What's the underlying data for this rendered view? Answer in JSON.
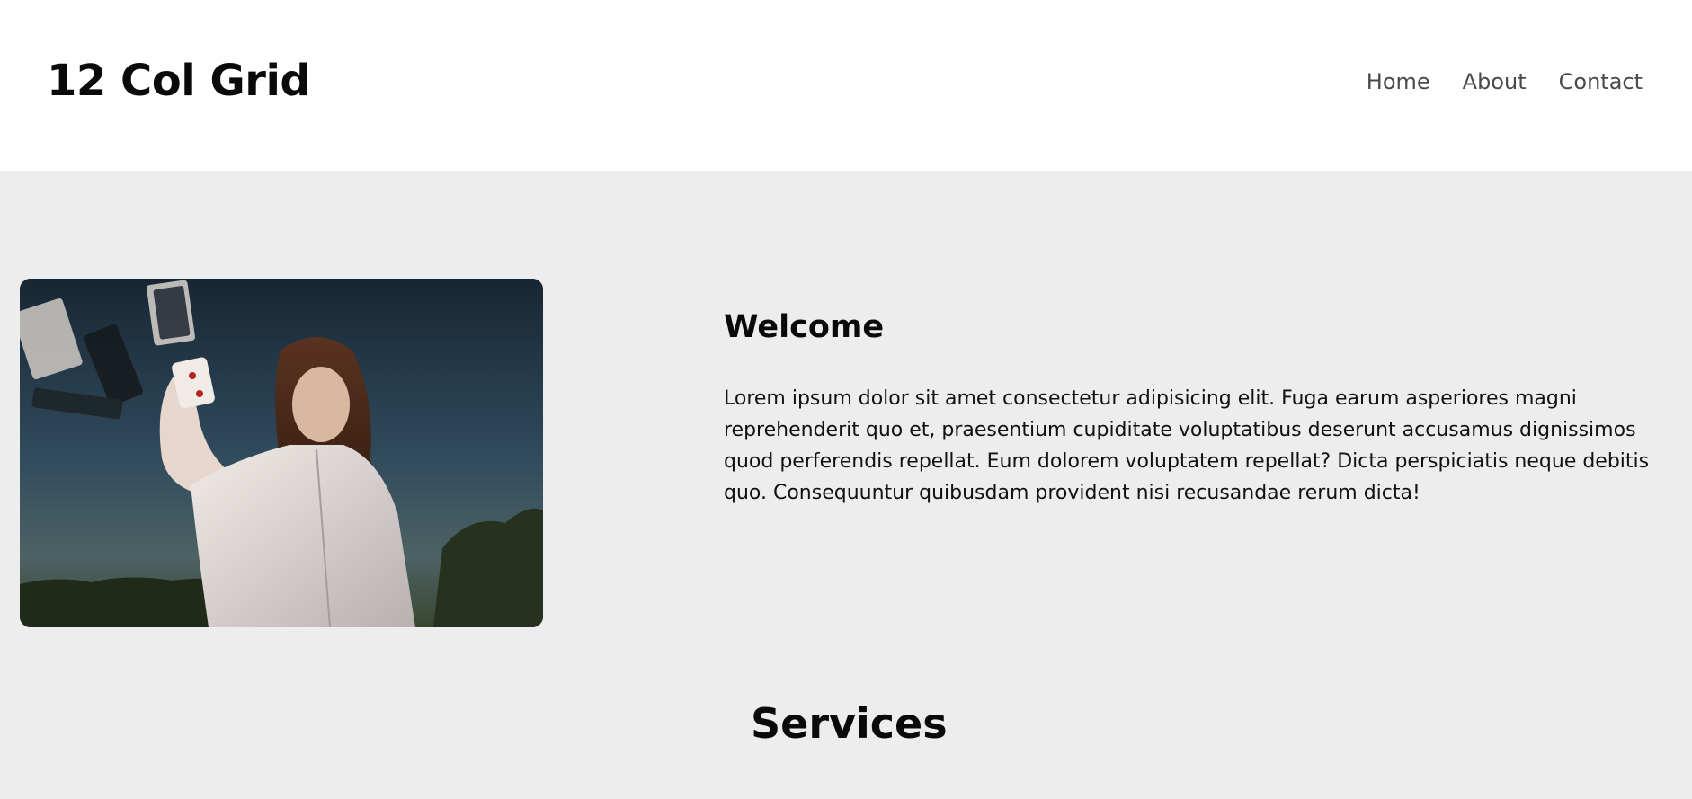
{
  "header": {
    "logo": "12 Col Grid",
    "nav": [
      {
        "label": "Home"
      },
      {
        "label": "About"
      },
      {
        "label": "Contact"
      }
    ]
  },
  "welcome": {
    "title": "Welcome",
    "body": "Lorem ipsum dolor sit amet consectetur adipisicing elit. Fuga earum asperiores magni reprehenderit quo et, praesentium cupiditate voluptatibus deserunt accusamus dignissimos quod perferendis repellat. Eum dolorem voluptatem repellat? Dicta perspiciatis neque debitis quo. Consequuntur quibusdam provident nisi recusandae rerum dicta!"
  },
  "services": {
    "title": "Services"
  },
  "colors": {
    "page_background": "#ededed",
    "header_background": "#ffffff",
    "text": "#0a0a0a",
    "nav_text": "#4a4a4a"
  }
}
